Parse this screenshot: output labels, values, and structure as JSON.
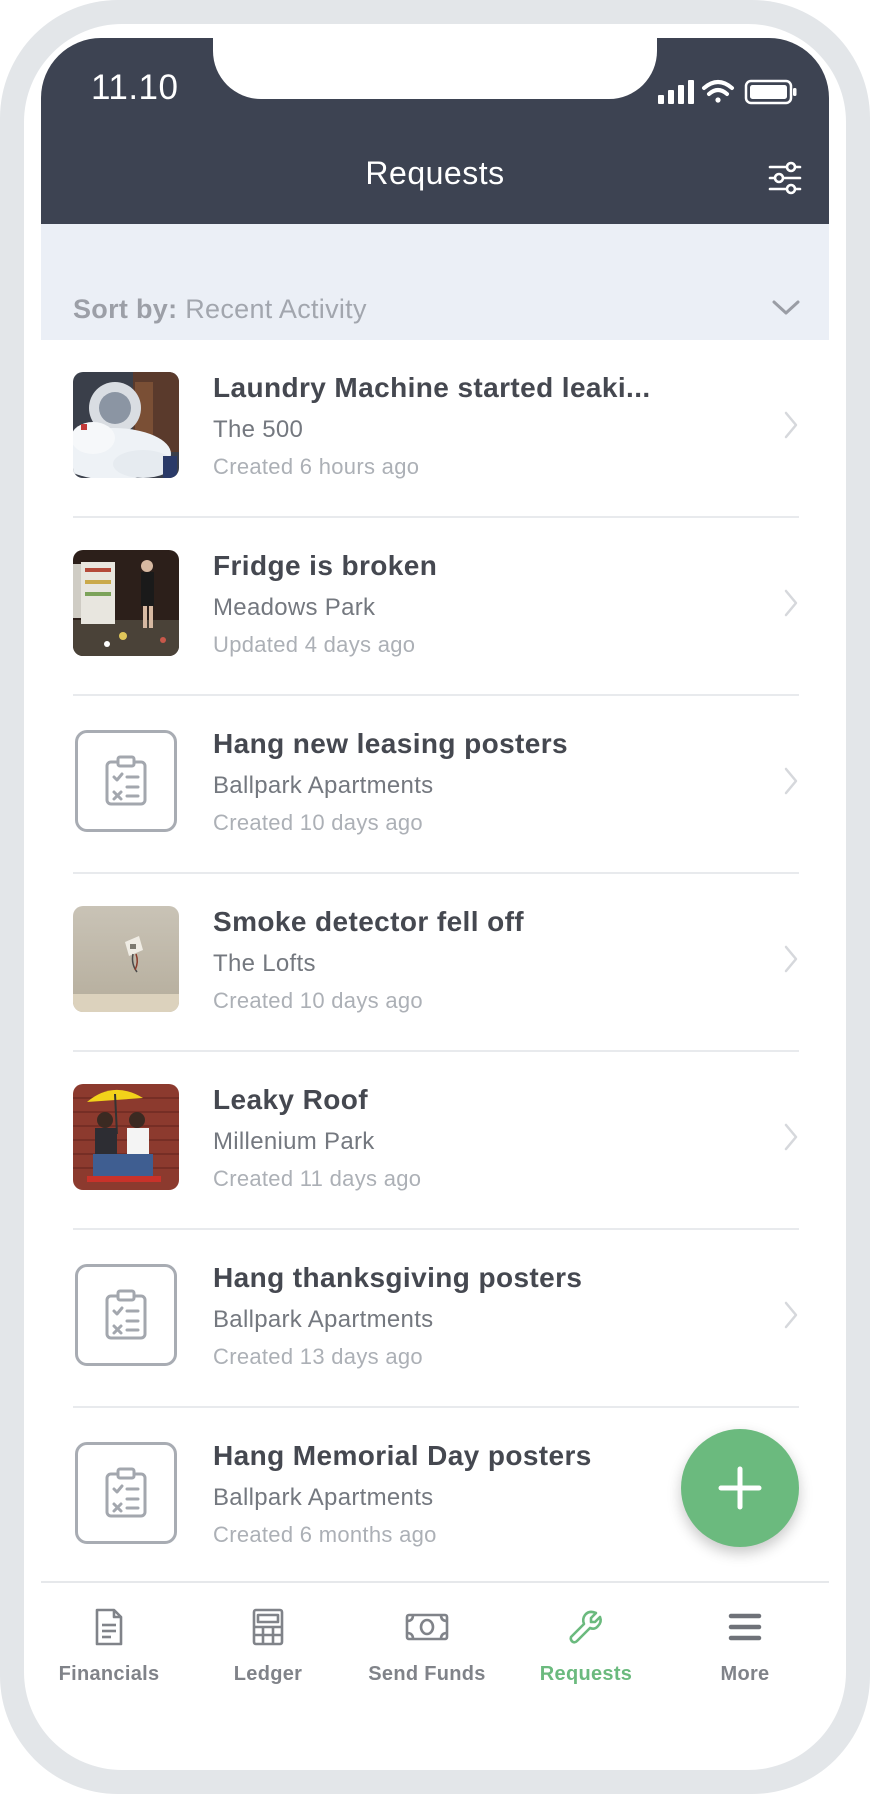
{
  "status_bar": {
    "time": "11.10"
  },
  "header": {
    "title": "Requests"
  },
  "sort": {
    "label": "Sort by:",
    "value": "Recent Activity"
  },
  "requests": [
    {
      "title": "Laundry Machine started leaki...",
      "property": "The 500",
      "meta": "Created 6 hours ago",
      "thumb": "laundry-photo"
    },
    {
      "title": "Fridge is broken",
      "property": "Meadows Park",
      "meta": "Updated 4 days ago",
      "thumb": "fridge-photo"
    },
    {
      "title": "Hang new leasing posters",
      "property": "Ballpark Apartments",
      "meta": "Created 10 days ago",
      "thumb": "clipboard-icon"
    },
    {
      "title": "Smoke detector fell off",
      "property": "The Lofts",
      "meta": "Created 10 days ago",
      "thumb": "smoke-detector-photo"
    },
    {
      "title": "Leaky Roof",
      "property": "Millenium Park",
      "meta": "Created 11 days ago",
      "thumb": "leaky-roof-photo"
    },
    {
      "title": "Hang thanksgiving posters",
      "property": "Ballpark Apartments",
      "meta": "Created 13 days ago",
      "thumb": "clipboard-icon"
    },
    {
      "title": "Hang Memorial Day posters",
      "property": "Ballpark Apartments",
      "meta": "Created 6 months ago",
      "thumb": "clipboard-icon"
    }
  ],
  "tabs": [
    {
      "label": "Financials",
      "icon": "document-icon",
      "active": false
    },
    {
      "label": "Ledger",
      "icon": "calculator-icon",
      "active": false
    },
    {
      "label": "Send Funds",
      "icon": "money-icon",
      "active": false
    },
    {
      "label": "Requests",
      "icon": "wrench-icon",
      "active": true
    },
    {
      "label": "More",
      "icon": "menu-icon",
      "active": false
    }
  ],
  "colors": {
    "header_bg": "#3d4352",
    "sort_bg": "#ebeff6",
    "accent_green": "#6bba7e"
  }
}
